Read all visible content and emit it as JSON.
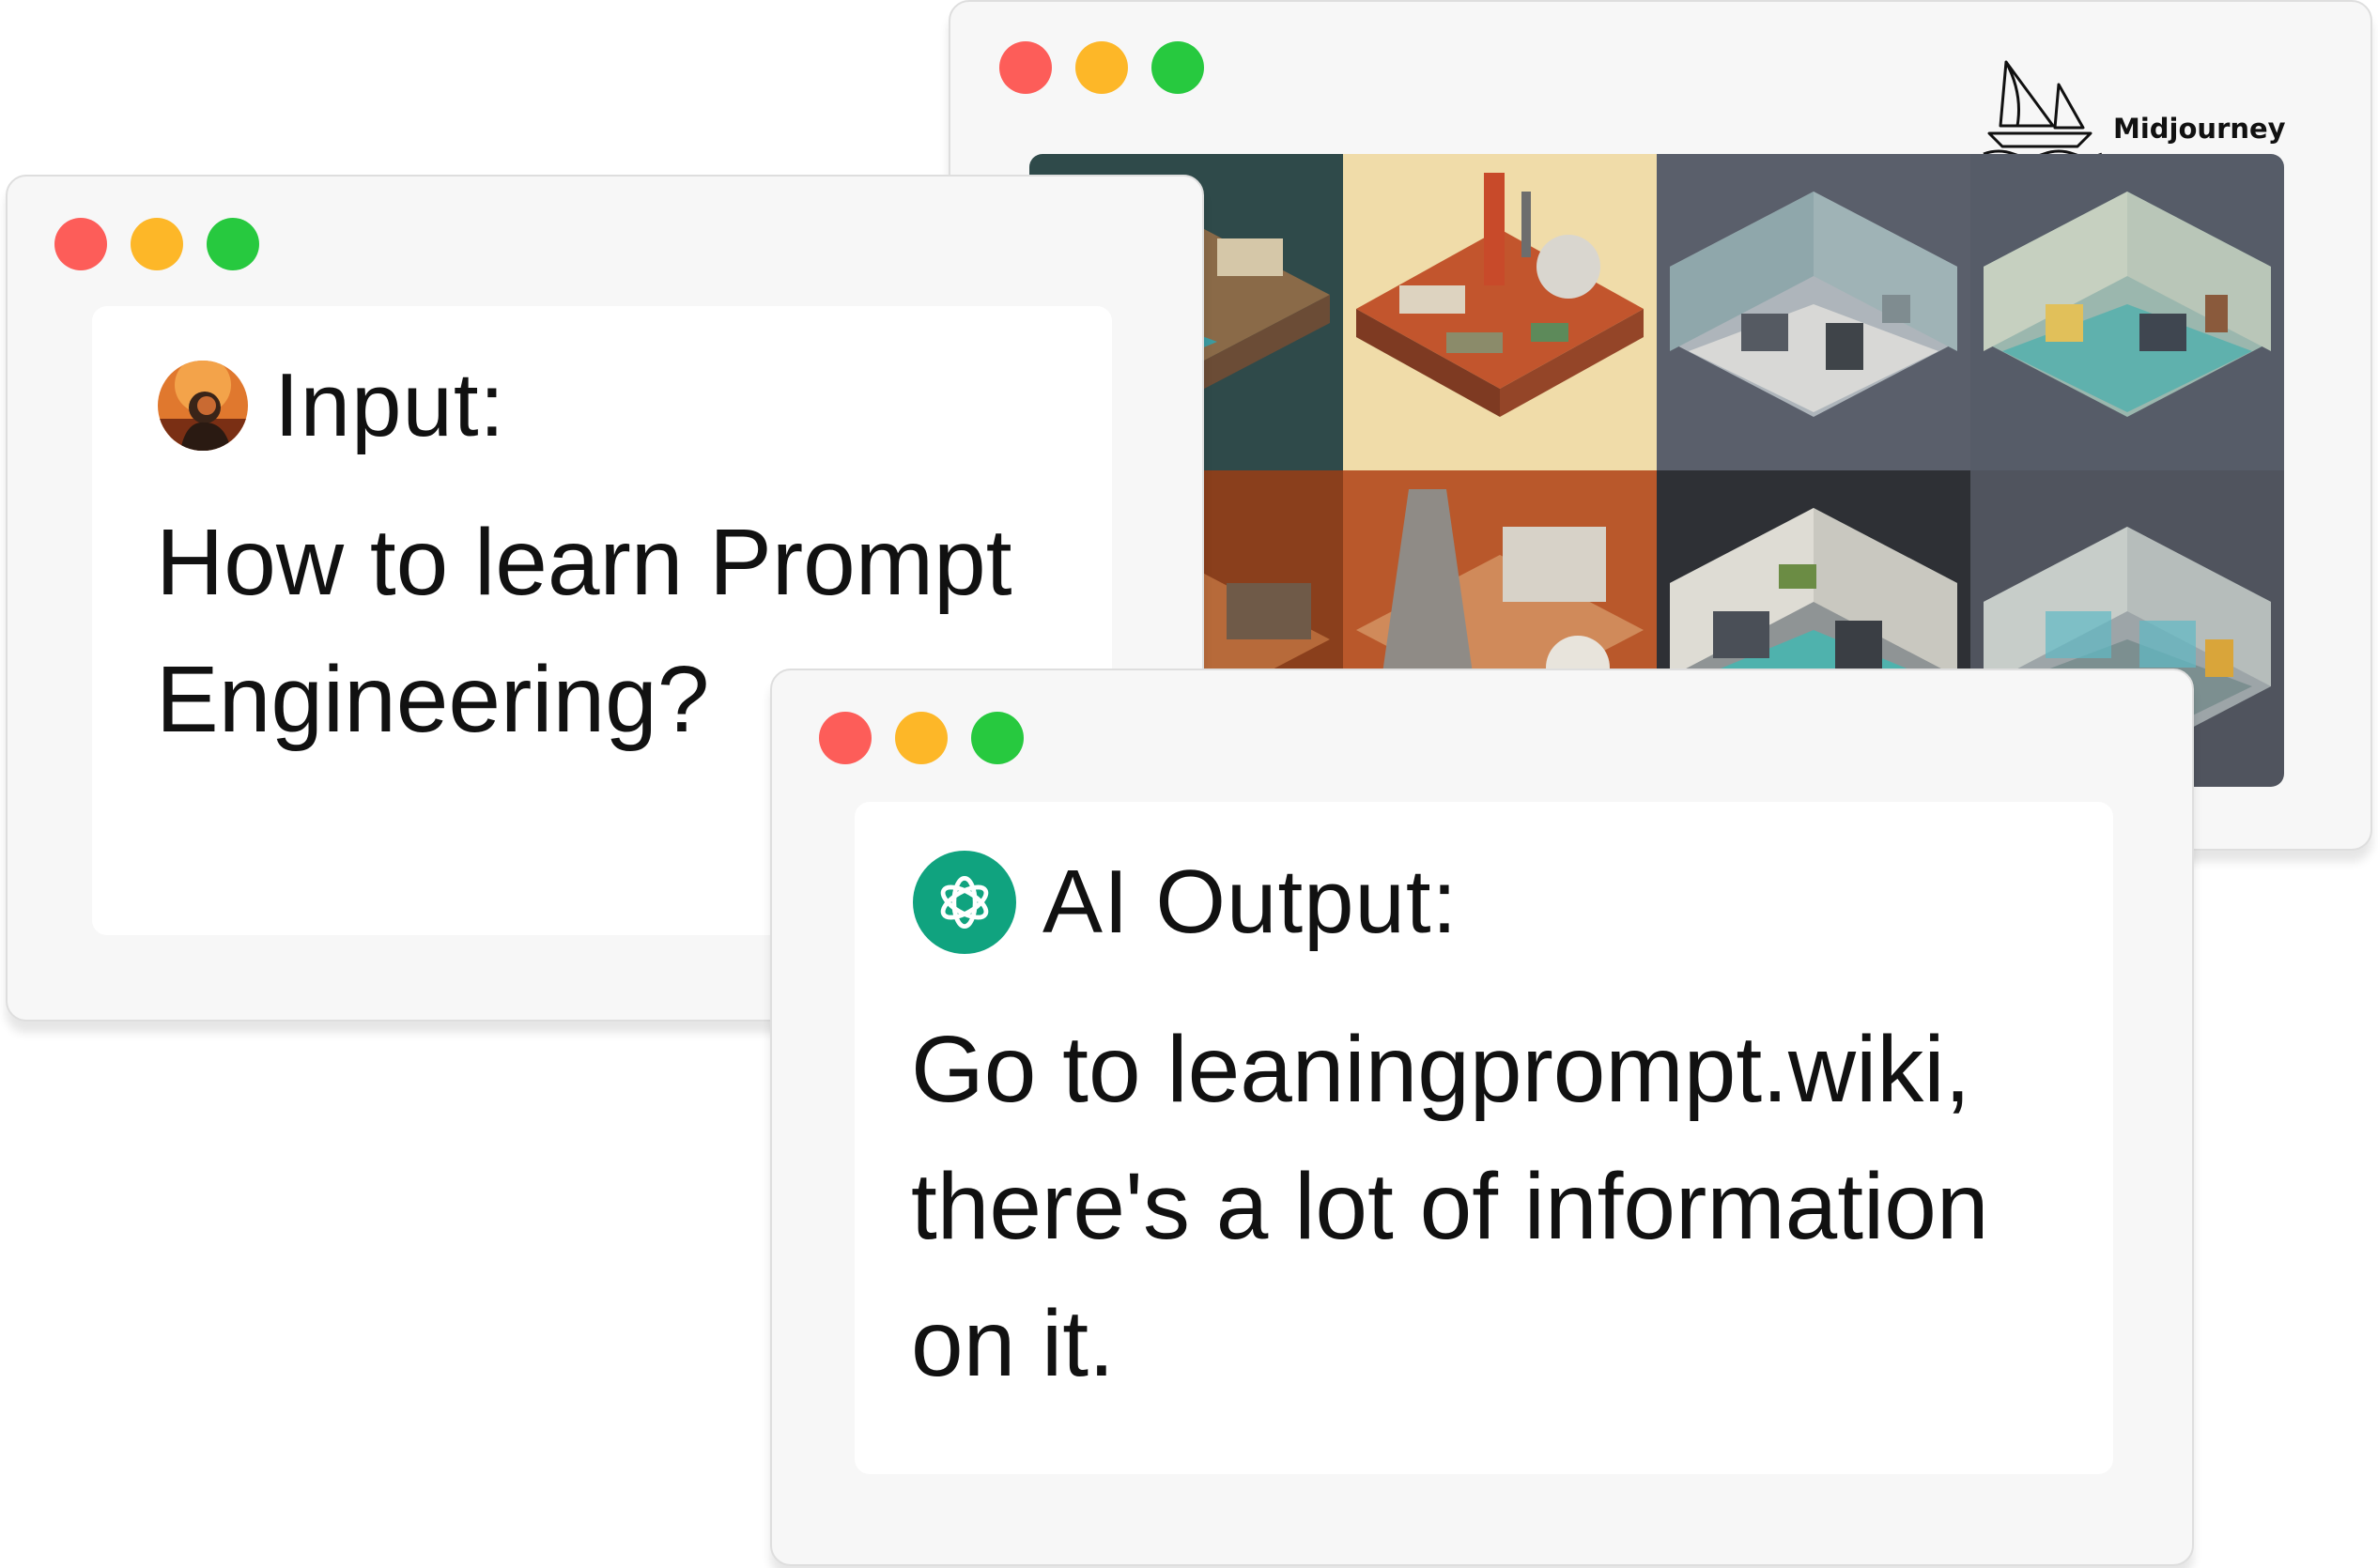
{
  "midjourney_window": {
    "brand_name": "Midjourney",
    "logo_icon": "sailboat-icon",
    "grid_images": [
      {
        "subject": "isometric industrial plant",
        "bg": "#2f4a4a"
      },
      {
        "subject": "isometric orange factory",
        "bg": "#f0dca9"
      },
      {
        "subject": "isometric laboratory room",
        "bg": "#5a5f6b"
      },
      {
        "subject": "isometric teal laboratory",
        "bg": "#565c68"
      },
      {
        "subject": "isometric refinery towers",
        "bg": "#8a3f1c"
      },
      {
        "subject": "isometric power plant",
        "bg": "#b9582b"
      },
      {
        "subject": "isometric dark laboratory",
        "bg": "#2e3035"
      },
      {
        "subject": "isometric glass laboratory",
        "bg": "#50545e"
      }
    ]
  },
  "input_window": {
    "heading": "Input:",
    "avatar_icon": "astronaut-avatar",
    "lines": [
      "How to learn Prompt",
      "Engineering?"
    ]
  },
  "output_window": {
    "heading": "AI Output:",
    "logo_icon": "openai-icon",
    "lines": [
      "Go to leaningprompt.wiki,",
      "there's a lot of information",
      "on it."
    ]
  },
  "colors": {
    "close": "#fd5d59",
    "minimize": "#fdb728",
    "maximize": "#27c93f",
    "openai_green": "#10a37f"
  }
}
